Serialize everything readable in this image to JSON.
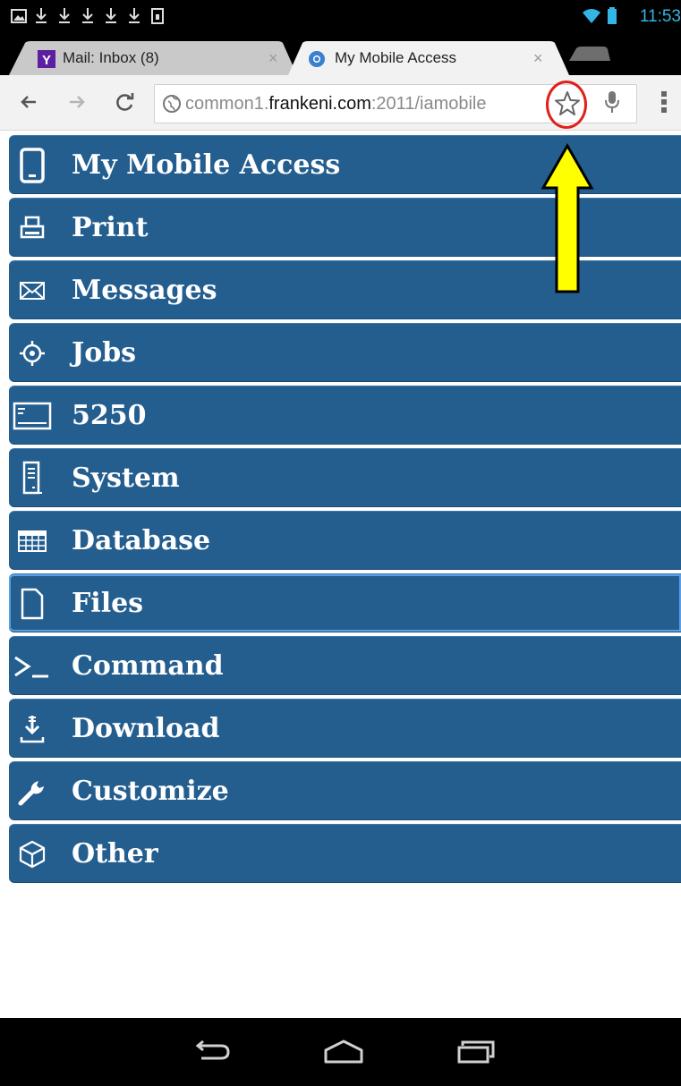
{
  "status_bar": {
    "time": "11:53",
    "icons": [
      "image-icon",
      "download-icon",
      "download-icon",
      "download-icon",
      "download-icon",
      "download-icon",
      "sd-card-icon",
      "wifi-icon",
      "battery-icon"
    ]
  },
  "tabs": [
    {
      "title": "Mail: Inbox (8)",
      "favicon": "yahoo-favicon",
      "close": "×",
      "active": false
    },
    {
      "title": "My Mobile Access",
      "favicon": "globe-favicon",
      "close": "×",
      "active": true
    }
  ],
  "toolbar": {
    "url_host_prefix": "common1.",
    "url_host_domain": "frankeni.com",
    "url_rest": ":2011/iamobile"
  },
  "menu": {
    "items": [
      {
        "label": "My Mobile Access",
        "icon": "tablet-icon"
      },
      {
        "label": "Print",
        "icon": "printer-icon"
      },
      {
        "label": "Messages",
        "icon": "envelope-icon"
      },
      {
        "label": "Jobs",
        "icon": "target-icon"
      },
      {
        "label": "5250",
        "icon": "terminal-screen-icon"
      },
      {
        "label": "System",
        "icon": "server-icon"
      },
      {
        "label": "Database",
        "icon": "table-icon"
      },
      {
        "label": "Files",
        "icon": "file-icon"
      },
      {
        "label": "Command",
        "icon": "command-prompt-icon"
      },
      {
        "label": "Download",
        "icon": "download-icon"
      },
      {
        "label": "Customize",
        "icon": "wrench-icon"
      },
      {
        "label": "Other",
        "icon": "cube-icon"
      }
    ],
    "active_index": 7,
    "color": "#245e8f"
  },
  "annotation": {
    "arrow_color": "#ffff00",
    "highlight_color": "#e0201a"
  },
  "colors": {
    "status_accent": "#33b5e5",
    "menu_bg": "#245e8f"
  }
}
